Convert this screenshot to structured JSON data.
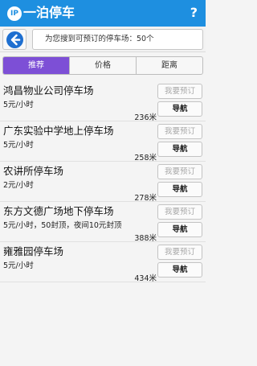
{
  "header": {
    "logo_text": "IP",
    "title": "一泊停车",
    "help": "?"
  },
  "summary": "为您搜到可预订的停车场：50个",
  "tabs": [
    {
      "label": "推荐",
      "active": true
    },
    {
      "label": "价格",
      "active": false
    },
    {
      "label": "距离",
      "active": false
    }
  ],
  "buttons": {
    "reserve": "我要预订",
    "navigate": "导航"
  },
  "lots": [
    {
      "name": "鸿昌物业公司停车场",
      "price": "5元/小时",
      "distance": "236米"
    },
    {
      "name": "广东实验中学地上停车场",
      "price": "5元/小时",
      "distance": "258米"
    },
    {
      "name": "农讲所停车场",
      "price": "2元/小时",
      "distance": "278米"
    },
    {
      "name": "东方文德广场地下停车场",
      "price": "5元/小时，50封顶，夜间10元封顶",
      "distance": "388米"
    },
    {
      "name": "雍雅园停车场",
      "price": "5元/小时",
      "distance": "434米"
    }
  ],
  "colors": {
    "header_bg": "#1e8fe0",
    "tab_active": "#7d4fd6",
    "back_icon": "#1e6fd0"
  },
  "icons": {
    "back": "left-arrow-circle-icon",
    "logo": "parking-location-icon"
  }
}
